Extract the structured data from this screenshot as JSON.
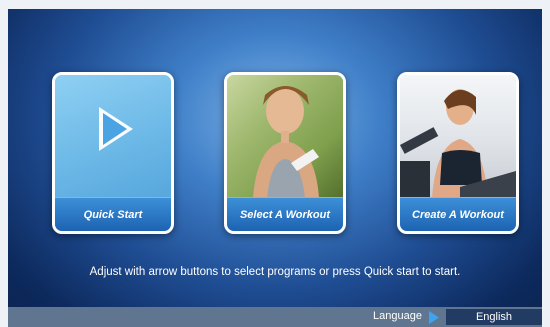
{
  "cards": [
    {
      "label": "Quick Start",
      "icon": "play-icon"
    },
    {
      "label": "Select A Workout",
      "image": "runner-woman-photo"
    },
    {
      "label": "Create A Workout",
      "image": "treadmill-woman-photo"
    }
  ],
  "hint": "Adjust with arrow buttons to select programs or press Quick start to start.",
  "footer": {
    "language_label": "Language",
    "language_value": "English",
    "arrow_icon": "triangle-right-icon"
  },
  "colors": {
    "accent_blue": "#1d63b2",
    "arrow_blue": "#3fa3f0",
    "frame": "#eef1f5"
  }
}
